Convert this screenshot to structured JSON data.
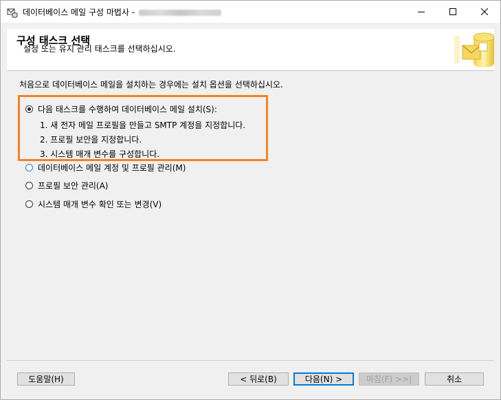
{
  "window": {
    "title": "데이터베이스 메일 구성 마법사 -"
  },
  "header": {
    "title": "구성 태스크 선택",
    "subtitle": "설정 또는 유지 관리 태스크를 선택하십시오."
  },
  "content": {
    "intro": "처음으로 데이터베이스 메일을 설치하는 경우에는 설치 옵션을 선택하십시오.",
    "options": [
      {
        "label": "다음 태스크를 수행하여 데이터베이스 메일 설치(S):",
        "selected": true
      },
      {
        "label": "데이터베이스 메일 계정 및 프로필 관리(M)",
        "selected": false
      },
      {
        "label": "프로필 보안 관리(A)",
        "selected": false
      },
      {
        "label": "시스템 매개 변수 확인 또는 변경(V)",
        "selected": false
      }
    ],
    "steps": [
      "1. 새 전자 메일 프로필을 만들고 SMTP 계정을 지정합니다.",
      "2. 프로필 보안을 지정합니다.",
      "3. 시스템 매개 변수를 구성합니다."
    ]
  },
  "buttons": {
    "help": "도움말(H)",
    "back": "< 뒤로(B)",
    "next": "다음(N) >",
    "finish": "마침(F) >>|",
    "cancel": "취소"
  },
  "colors": {
    "highlight": "#f58220",
    "focus": "#0078d7"
  }
}
